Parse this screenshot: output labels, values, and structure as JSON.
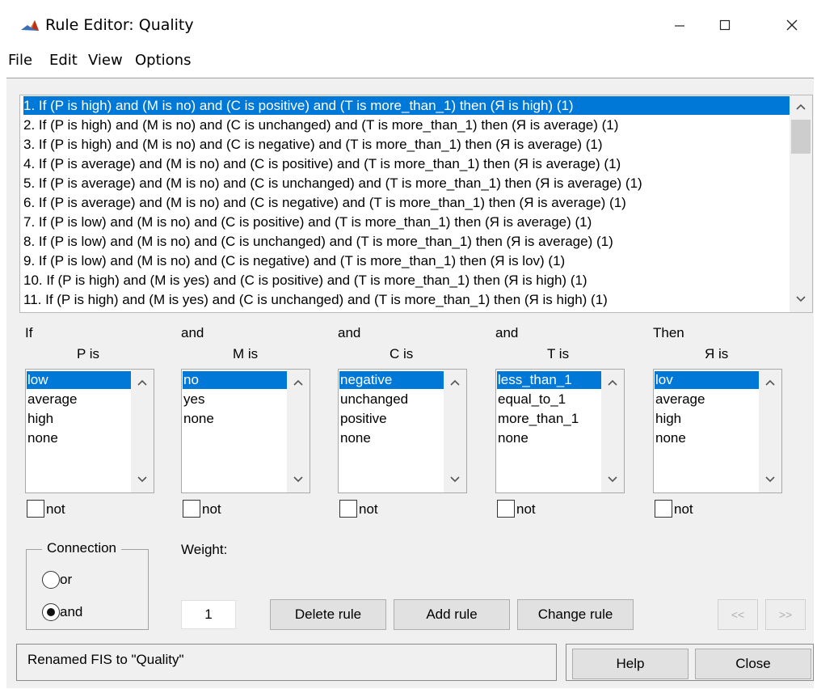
{
  "window": {
    "title": "Rule Editor: Quality",
    "controls": [
      "minimize-icon",
      "maximize-icon",
      "close-icon"
    ]
  },
  "menu": [
    "File",
    "Edit",
    "View",
    "Options"
  ],
  "rules": [
    "1. If (P is high) and (M is no) and (C is positive) and (T is more_than_1) then (Я is high) (1)",
    "2. If (P is high) and (M is no) and (C is unchanged) and (T is more_than_1) then (Я is average) (1)",
    "3. If (P is high) and (M is no) and (C is negative) and (T is more_than_1) then (Я is average) (1)",
    "4. If (P is average) and (M is no) and (C is positive) and (T is more_than_1) then (Я is average) (1)",
    "5. If (P is average) and (M is no) and (C is unchanged) and (T is more_than_1) then (Я is average) (1)",
    "6. If (P is average) and (M is no) and (C is negative) and (T is more_than_1) then (Я is average) (1)",
    "7. If (P is low) and (M is no) and (C is positive) and (T is more_than_1) then (Я is average) (1)",
    "8. If (P is low) and (M is no) and (C is unchanged) and (T is more_than_1) then (Я is average) (1)",
    "9. If (P is low) and (M is no) and (C is negative) and (T is more_than_1) then (Я is lov) (1)",
    "10. If (P is high) and (M is yes) and (C is positive) and (T is more_than_1) then (Я is high) (1)",
    "11. If (P is high) and (M is yes) and (C is unchanged) and (T is more_than_1) then (Я is high) (1)"
  ],
  "selected_rule_index": 0,
  "columns": [
    {
      "connector": "If",
      "label": "P is",
      "options": [
        "low",
        "average",
        "high",
        "none"
      ],
      "selected": 0,
      "not_label": "not"
    },
    {
      "connector": "and",
      "label": "M is",
      "options": [
        "no",
        "yes",
        "none"
      ],
      "selected": 0,
      "not_label": "not"
    },
    {
      "connector": "and",
      "label": "C is",
      "options": [
        "negative",
        "unchanged",
        "positive",
        "none"
      ],
      "selected": 0,
      "not_label": "not"
    },
    {
      "connector": "and",
      "label": "T is",
      "options": [
        "less_than_1",
        "equal_to_1",
        "more_than_1",
        "none"
      ],
      "selected": 0,
      "not_label": "not"
    },
    {
      "connector": "Then",
      "label": "Я is",
      "options": [
        "lov",
        "average",
        "high",
        "none"
      ],
      "selected": 0,
      "not_label": "not"
    }
  ],
  "connection": {
    "title": "Connection",
    "options": [
      "or",
      "and"
    ],
    "selected": "and"
  },
  "weight": {
    "label": "Weight:",
    "value": "1"
  },
  "buttons": {
    "delete": "Delete rule",
    "add": "Add rule",
    "change": "Change rule",
    "prev": "<<",
    "next": ">>",
    "help": "Help",
    "close": "Close"
  },
  "status": "Renamed FIS to \"Quality\"",
  "colors": {
    "selection": "#0078d7",
    "panel": "#f0f0f0"
  }
}
